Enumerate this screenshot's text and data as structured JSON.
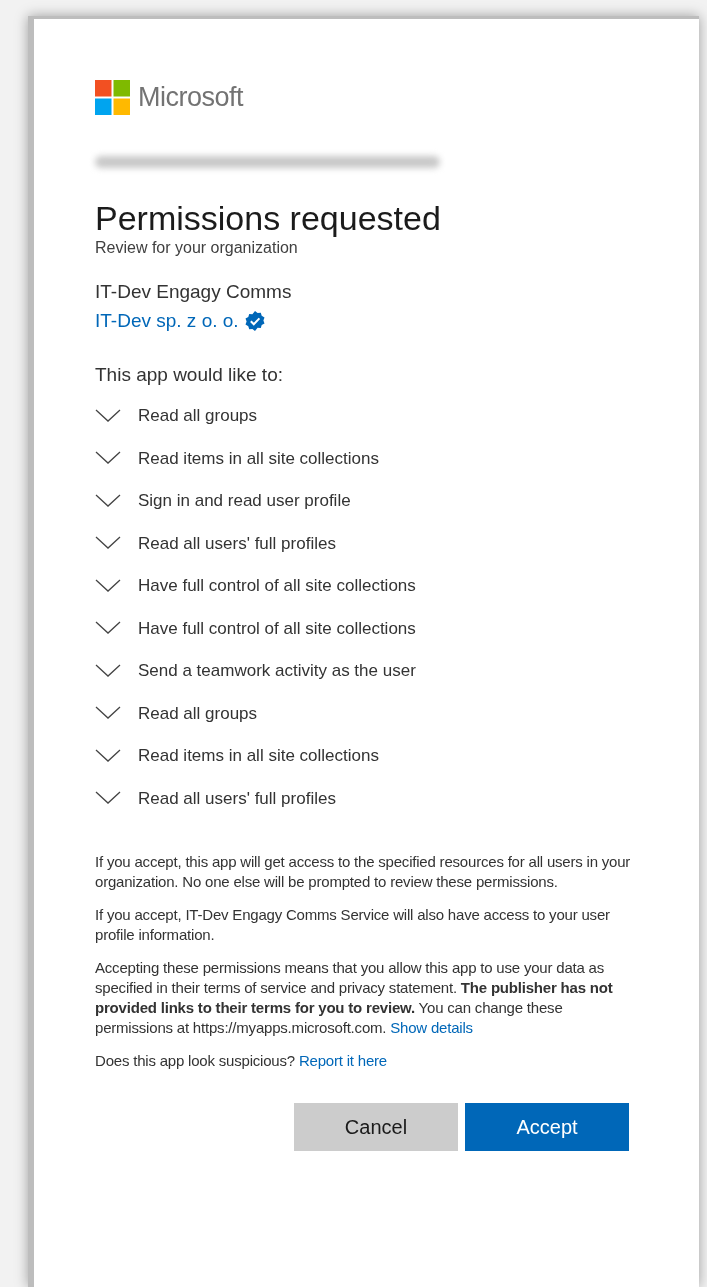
{
  "logo": {
    "text": "Microsoft"
  },
  "title": "Permissions requested",
  "subtitle": "Review for your organization",
  "app": {
    "name": "IT-Dev Engagy Comms",
    "publisher": "IT-Dev sp. z o. o.",
    "verified": true
  },
  "permissions_heading": "This app would like to:",
  "permissions": [
    {
      "label": "Read all groups",
      "expanded": false
    },
    {
      "label": "Read items in all site collections",
      "expanded": false
    },
    {
      "label": "Sign in and read user profile",
      "expanded": false
    },
    {
      "label": "Read all users' full profiles",
      "expanded": false
    },
    {
      "label": "Have full control of all site collections",
      "expanded": false
    },
    {
      "label": "Have full control of all site collections",
      "expanded": false
    },
    {
      "label": "Send a teamwork activity as the user",
      "expanded": false
    },
    {
      "label": "Read all groups",
      "expanded": false
    },
    {
      "label": "Read items in all site collections",
      "expanded": false
    },
    {
      "label": "Read all users' full profiles",
      "expanded": false
    }
  ],
  "notices": [
    {
      "text": "If you accept, this app will get access to the specified resources for all users in your organization. No one else will be prompted to review these permissions."
    },
    {
      "text": "If you accept, IT-Dev Engagy Comms Service will also have access to your user profile information."
    },
    {
      "text": "Accepting these permissions means that you allow this app to use your data as specified in their terms of service and privacy statement. **The publisher has not provided links to their terms for you to review.** You can change these permissions at https://myapps.microsoft.com.",
      "link": "Show details"
    },
    {
      "text": "Does this app look suspicious?",
      "link": "Report it here"
    }
  ],
  "buttons": [
    {
      "label": "Cancel",
      "kind": "secondary"
    },
    {
      "label": "Accept",
      "kind": "primary"
    }
  ]
}
